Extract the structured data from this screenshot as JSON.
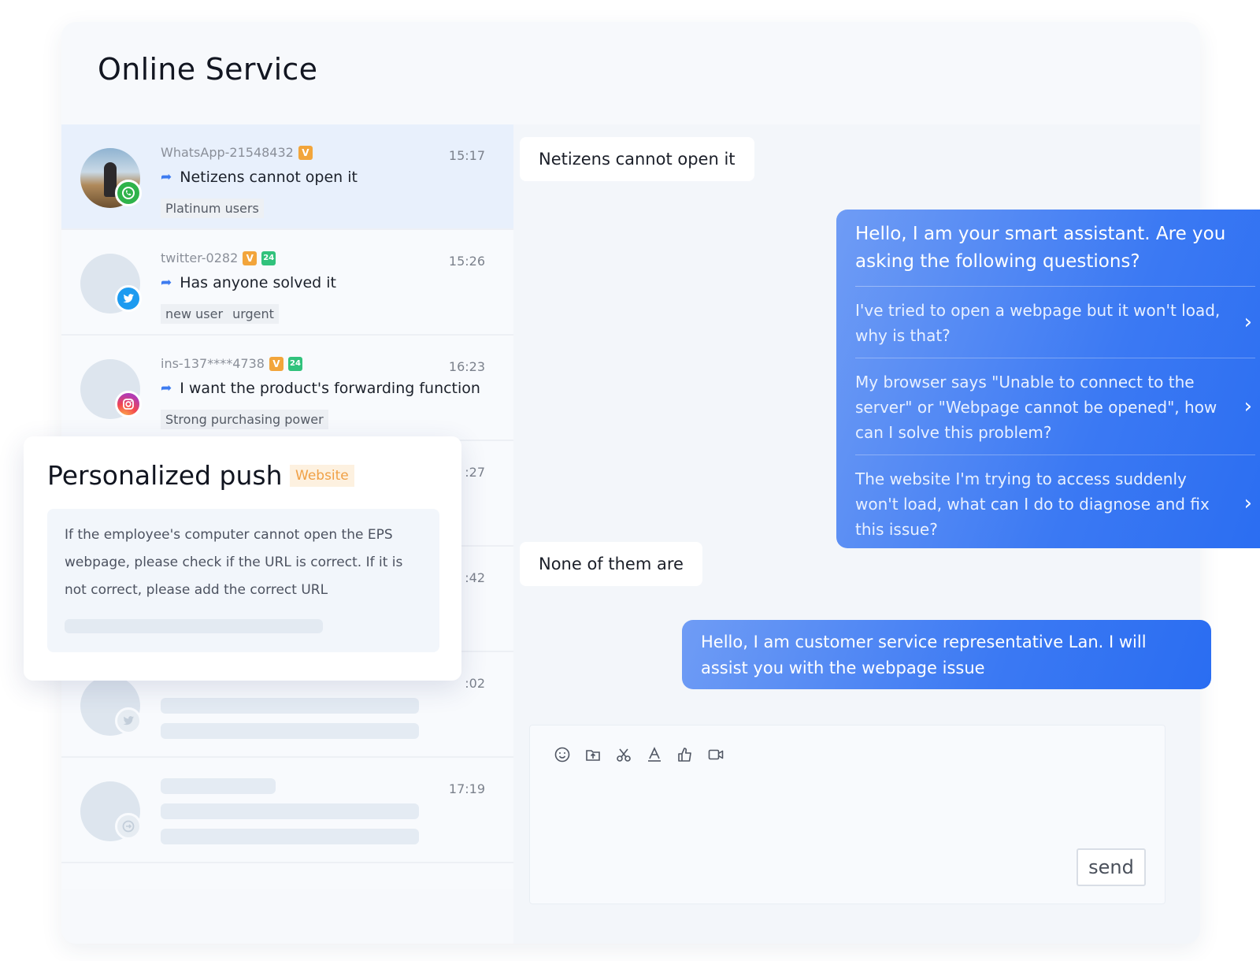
{
  "panel": {
    "title": "Online Service"
  },
  "conversations": [
    {
      "name": "WhatsApp-21548432",
      "badges": [
        "V"
      ],
      "time": "15:17",
      "message": "Netizens cannot open it",
      "tags": [
        "Platinum users"
      ],
      "platform": "whatsapp-icon"
    },
    {
      "name": "twitter-0282",
      "badges": [
        "V",
        "24"
      ],
      "time": "15:26",
      "message": "Has anyone solved it",
      "tags": [
        "new user",
        "urgent"
      ],
      "platform": "twitter-icon"
    },
    {
      "name": "ins-137****4738",
      "badges": [
        "V",
        "24"
      ],
      "time": "16:23",
      "message": "I want the product's forwarding function",
      "tags": [
        "Strong purchasing power"
      ],
      "platform": "instagram-icon"
    },
    {
      "time_partial": ":27"
    },
    {
      "time_partial": ":42"
    },
    {
      "time_partial": ":02"
    },
    {
      "time": "17:19"
    }
  ],
  "personalized_push": {
    "title": "Personalized push",
    "badge": "Website",
    "body": "If the employee's computer cannot open the EPS webpage, please check if the URL is correct. If it is not correct, please add the correct URL"
  },
  "chat": {
    "user_message_1": "Netizens cannot open it",
    "assistant": {
      "intro": "Hello, I am your smart assistant. Are you asking the following questions?",
      "questions": [
        "I've tried to open a webpage but it won't load, why is that?",
        "My browser says \"Unable to connect to the server\" or \"Webpage cannot be opened\", how can I solve this problem?",
        "The website I'm trying to access suddenly won't load, what can I do to diagnose and fix this issue?"
      ]
    },
    "user_message_2": "None of them are",
    "agent_message": "Hello, I am customer service representative Lan. I will assist you with the webpage issue"
  },
  "composer": {
    "tools": [
      "emoji-icon",
      "upload-file-icon",
      "scissors-icon",
      "text-format-icon",
      "thumbs-up-icon",
      "video-icon"
    ],
    "send_label": "send"
  },
  "colors": {
    "accent": "#3b79f3",
    "whatsapp": "#2fb34b",
    "twitter": "#1d9bf0",
    "badge_v": "#f2a53b",
    "badge_24": "#31c27c",
    "push_badge": "#f0a045"
  }
}
